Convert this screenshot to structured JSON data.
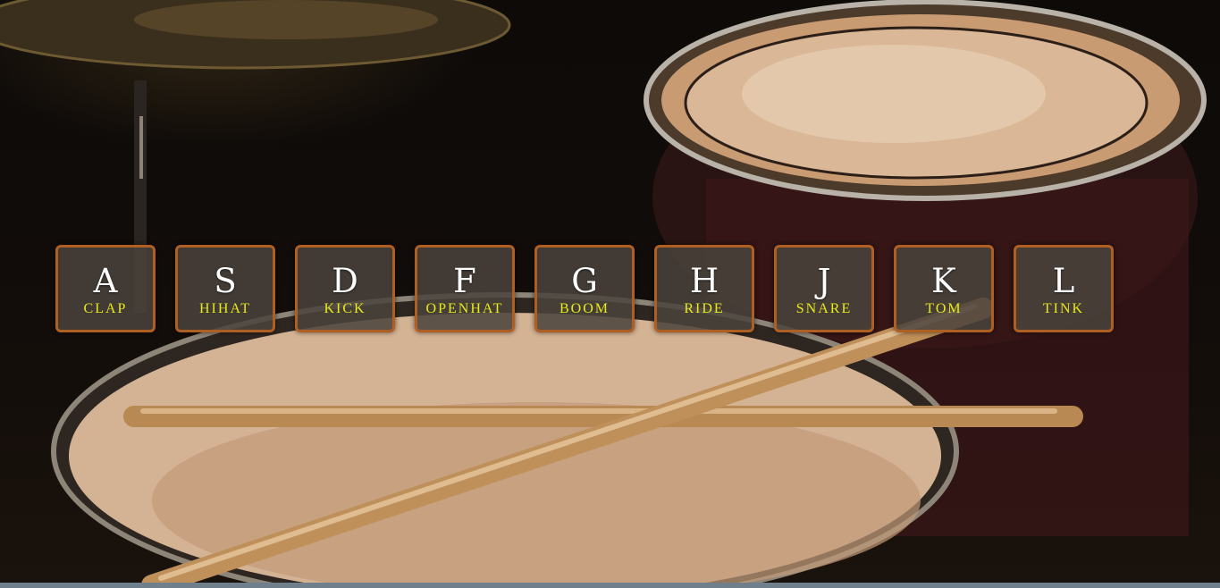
{
  "background": {
    "image": "drum-kit-photo"
  },
  "colors": {
    "key_border": "#b05f23",
    "key_background": "#4b433c",
    "key_letter": "#ffffff",
    "key_sound": "#e6e91a"
  },
  "keys": [
    {
      "letter": "A",
      "sound": "CLAP"
    },
    {
      "letter": "S",
      "sound": "HIHAT"
    },
    {
      "letter": "D",
      "sound": "KICK"
    },
    {
      "letter": "F",
      "sound": "OPENHAT"
    },
    {
      "letter": "G",
      "sound": "BOOM"
    },
    {
      "letter": "H",
      "sound": "RIDE"
    },
    {
      "letter": "J",
      "sound": "SNARE"
    },
    {
      "letter": "K",
      "sound": "TOM"
    },
    {
      "letter": "L",
      "sound": "TINK"
    }
  ]
}
